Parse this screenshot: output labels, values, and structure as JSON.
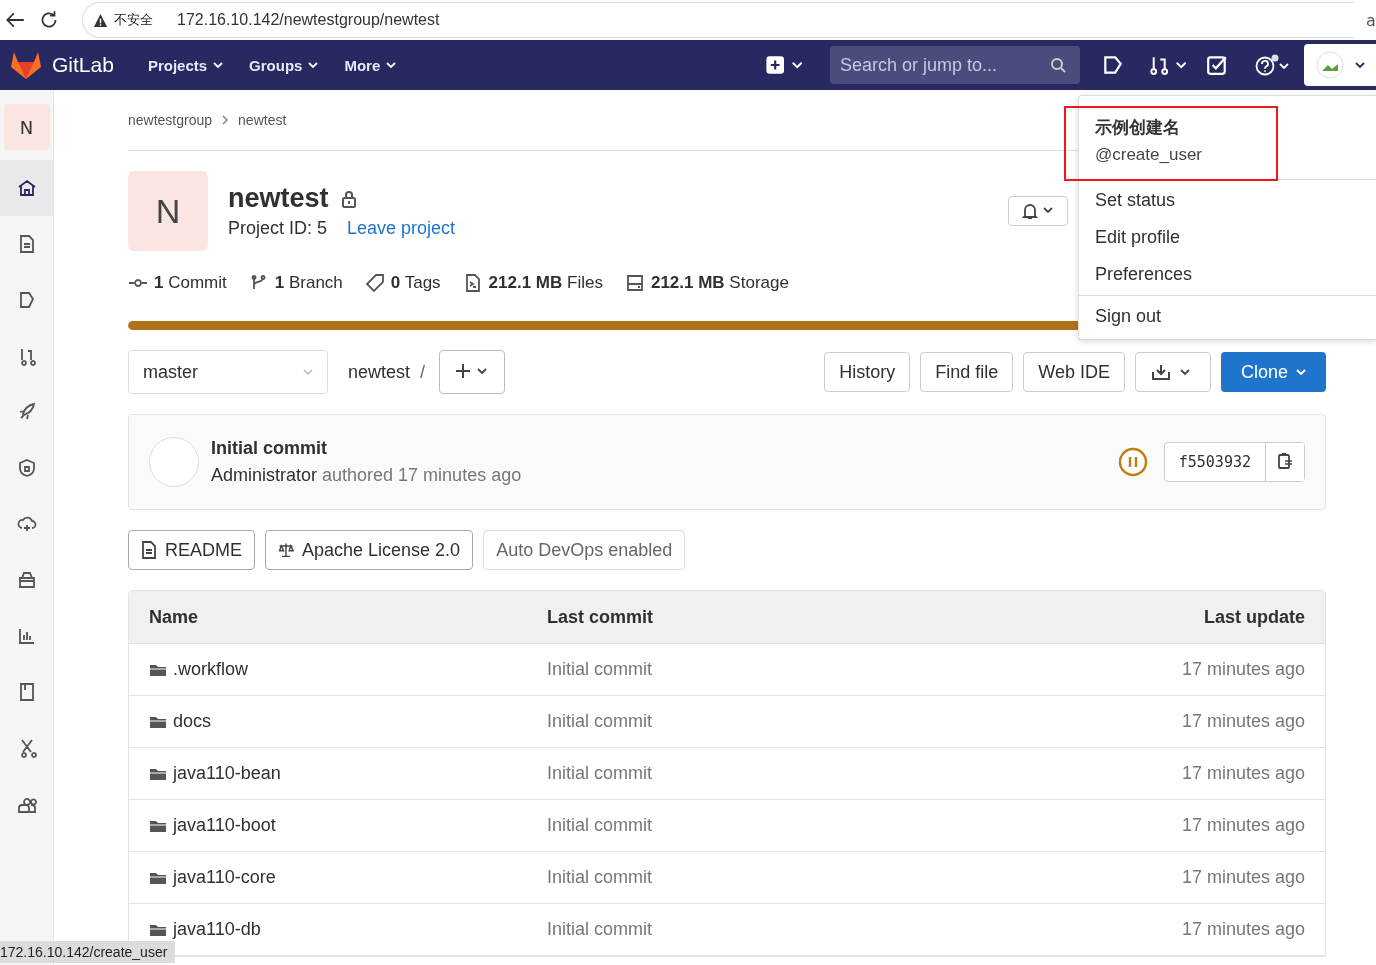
{
  "browser": {
    "security": "不安全",
    "url": "172.16.10.142/newtestgroup/newtest",
    "edge_text": "a"
  },
  "navbar": {
    "brand": "GitLab",
    "menus": [
      {
        "label": "Projects"
      },
      {
        "label": "Groups"
      },
      {
        "label": "More"
      }
    ],
    "search": {
      "placeholder": "Search or jump to..."
    }
  },
  "sidebar": {
    "avatar": "N",
    "items": [
      {
        "kind": "home",
        "selected": true
      },
      {
        "kind": "document",
        "selected": false
      },
      {
        "kind": "issues",
        "selected": false
      },
      {
        "kind": "merge-request",
        "selected": false
      },
      {
        "kind": "rocket",
        "selected": false
      },
      {
        "kind": "shield",
        "selected": false
      },
      {
        "kind": "cloud",
        "selected": false
      },
      {
        "kind": "package",
        "selected": false
      },
      {
        "kind": "chart",
        "selected": false
      },
      {
        "kind": "book",
        "selected": false
      },
      {
        "kind": "scissors",
        "selected": false
      },
      {
        "kind": "users",
        "selected": false
      }
    ]
  },
  "breadcrumb": [
    "newtestgroup",
    "newtest"
  ],
  "project": {
    "avatar": "N",
    "name": "newtest",
    "id_text": "Project ID: 5",
    "leave": "Leave project"
  },
  "stats": [
    {
      "kind": "commit",
      "count": "1",
      "label": "Commit"
    },
    {
      "kind": "branch",
      "count": "1",
      "label": "Branch"
    },
    {
      "kind": "tag",
      "count": "0",
      "label": "Tags"
    },
    {
      "kind": "files",
      "count": "212.1 MB",
      "label": "Files"
    },
    {
      "kind": "storage",
      "count": "212.1 MB",
      "label": "Storage"
    }
  ],
  "storage_bar": {
    "level": 1
  },
  "repo_bar": {
    "branch": "master",
    "path": "newtest",
    "slash": "/",
    "buttons": [
      "History",
      "Find file",
      "Web IDE"
    ],
    "clone": "Clone"
  },
  "last_commit": {
    "title": "Initial commit",
    "author": "Administrator",
    "meta": "authored 17 minutes ago",
    "sha": "f5503932"
  },
  "badges": [
    {
      "kind": "readme",
      "label": "README"
    },
    {
      "kind": "license",
      "label": "Apache License 2.0"
    },
    {
      "kind": "plain",
      "label": "Auto DevOps enabled"
    }
  ],
  "table": {
    "columns": [
      "Name",
      "Last commit",
      "Last update"
    ],
    "rows": [
      {
        "name": ".workflow",
        "commit": "Initial commit",
        "updated": "17 minutes ago"
      },
      {
        "name": "docs",
        "commit": "Initial commit",
        "updated": "17 minutes ago"
      },
      {
        "name": "java110-bean",
        "commit": "Initial commit",
        "updated": "17 minutes ago"
      },
      {
        "name": "java110-boot",
        "commit": "Initial commit",
        "updated": "17 minutes ago"
      },
      {
        "name": "java110-core",
        "commit": "Initial commit",
        "updated": "17 minutes ago"
      },
      {
        "name": "java110-db",
        "commit": "Initial commit",
        "updated": "17 minutes ago"
      }
    ]
  },
  "user_menu": {
    "display_name": "示例创建名",
    "username": "@create_user",
    "items": [
      "Set status",
      "Edit profile",
      "Preferences"
    ],
    "footer_items": [
      "Sign out"
    ]
  },
  "status_url": "172.16.10.142/create_user"
}
